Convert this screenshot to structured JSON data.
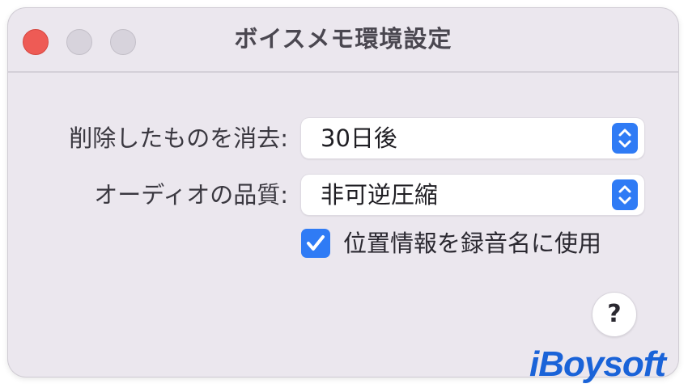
{
  "window": {
    "title": "ボイスメモ環境設定"
  },
  "settings": {
    "delete_label": "削除したものを消去:",
    "delete_value": "30日後",
    "quality_label": "オーディオの品質:",
    "quality_value": "非可逆圧縮",
    "location_checkbox_label": "位置情報を録音名に使用",
    "location_checked": true
  },
  "help": {
    "label": "?"
  },
  "watermark": {
    "text": "iBoysoft"
  },
  "colors": {
    "accent": "#2f7bf5",
    "close_button": "#ee5b55",
    "window_bg": "#ebe7ee",
    "watermark": "#1a63d8"
  },
  "icons": {
    "popup_arrows": "chevron-up-down-icon",
    "checkbox": "checkmark-icon"
  }
}
